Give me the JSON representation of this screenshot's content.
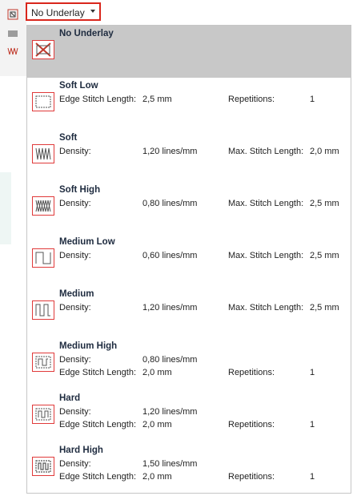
{
  "combo": {
    "label": "No Underlay"
  },
  "items": [
    {
      "title": "No Underlay",
      "icon": "no-underlay-icon",
      "rows": []
    },
    {
      "title": "Soft Low",
      "icon": "soft-low-icon",
      "rows": [
        {
          "label": "Edge Stitch Length:",
          "value": "2,5 mm",
          "label2": "Repetitions:",
          "value2": "1"
        }
      ]
    },
    {
      "title": "Soft",
      "icon": "soft-icon",
      "rows": [
        {
          "label": "Density:",
          "value": "1,20 lines/mm",
          "label2": "Max. Stitch Length:",
          "value2": "2,0 mm"
        }
      ]
    },
    {
      "title": "Soft High",
      "icon": "soft-high-icon",
      "rows": [
        {
          "label": "Density:",
          "value": "0,80 lines/mm",
          "label2": "Max. Stitch Length:",
          "value2": "2,5 mm"
        }
      ]
    },
    {
      "title": "Medium Low",
      "icon": "medium-low-icon",
      "rows": [
        {
          "label": "Density:",
          "value": "0,60 lines/mm",
          "label2": "Max. Stitch Length:",
          "value2": "2,5 mm"
        }
      ]
    },
    {
      "title": "Medium",
      "icon": "medium-icon",
      "rows": [
        {
          "label": "Density:",
          "value": "1,20 lines/mm",
          "label2": "Max. Stitch Length:",
          "value2": "2,5 mm"
        }
      ]
    },
    {
      "title": "Medium High",
      "icon": "medium-high-icon",
      "rows": [
        {
          "label": "Density:",
          "value": "0,80 lines/mm",
          "label2": "",
          "value2": ""
        },
        {
          "label": "Edge Stitch Length:",
          "value": "2,0 mm",
          "label2": "Repetitions:",
          "value2": "1"
        }
      ]
    },
    {
      "title": "Hard",
      "icon": "hard-icon",
      "rows": [
        {
          "label": "Density:",
          "value": "1,20 lines/mm",
          "label2": "",
          "value2": ""
        },
        {
          "label": "Edge Stitch Length:",
          "value": "2,0 mm",
          "label2": "Repetitions:",
          "value2": "1"
        }
      ]
    },
    {
      "title": "Hard High",
      "icon": "hard-high-icon",
      "rows": [
        {
          "label": "Density:",
          "value": "1,50 lines/mm",
          "label2": "",
          "value2": ""
        },
        {
          "label": "Edge Stitch Length:",
          "value": "2,0 mm",
          "label2": "Repetitions:",
          "value2": "1"
        }
      ]
    }
  ],
  "selected_index": 0
}
